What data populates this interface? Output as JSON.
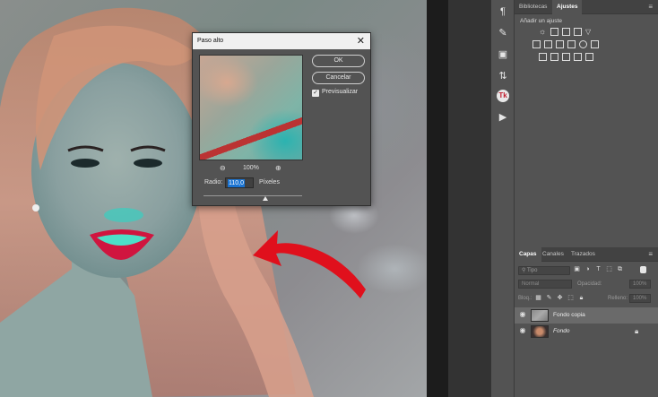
{
  "dialog": {
    "title": "Paso alto",
    "ok_label": "OK",
    "cancel_label": "Cancelar",
    "preview_label": "Previsualizar",
    "preview_checked": true,
    "zoom": "100%",
    "radius_label": "Radio:",
    "radius_value": "110,0",
    "radius_unit": "Píxeles"
  },
  "top_panel": {
    "tabs": [
      "Bibliotecas",
      "Ajustes"
    ],
    "active_tab": "Ajustes",
    "heading": "Añadir un ajuste"
  },
  "layers_panel": {
    "tabs": [
      "Capas",
      "Canales",
      "Trazados"
    ],
    "active_tab": "Capas",
    "filter_placeholder": "Tipo",
    "blend_mode": "Normal",
    "opacity_label": "Opacidad:",
    "opacity_value": "100%",
    "lock_label": "Bloq.:",
    "fill_label": "Relleno:",
    "fill_value": "100%",
    "layers": [
      {
        "name": "Fondo copia",
        "visible": true,
        "selected": true
      },
      {
        "name": "Fondo",
        "visible": true,
        "selected": false,
        "locked": true
      }
    ]
  },
  "colors": {
    "panel_bg": "#535353",
    "dark_bg": "#282828",
    "accent_selection": "#1a73d1",
    "annotation_arrow": "#e0101c"
  }
}
